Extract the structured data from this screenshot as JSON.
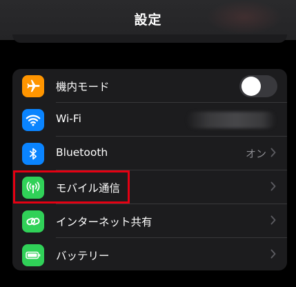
{
  "header": {
    "title": "設定"
  },
  "settings": {
    "rows": [
      {
        "label": "機内モード",
        "icon": "airplane-icon",
        "icon_bg": "#ff9500",
        "control": "toggle",
        "toggle_on": false
      },
      {
        "label": "Wi-Fi",
        "icon": "wifi-icon",
        "icon_bg": "#0a84ff",
        "control": "blurred-value"
      },
      {
        "label": "Bluetooth",
        "icon": "bluetooth-icon",
        "icon_bg": "#0a84ff",
        "value": "オン"
      },
      {
        "label": "モバイル通信",
        "icon": "antenna-icon",
        "icon_bg": "#30d158"
      },
      {
        "label": "インターネット共有",
        "icon": "link-icon",
        "icon_bg": "#30d158"
      },
      {
        "label": "バッテリー",
        "icon": "battery-icon",
        "icon_bg": "#30d158"
      }
    ]
  },
  "annotation": {
    "highlight_color": "#e50012",
    "highlighted_row": "モバイル通信"
  }
}
